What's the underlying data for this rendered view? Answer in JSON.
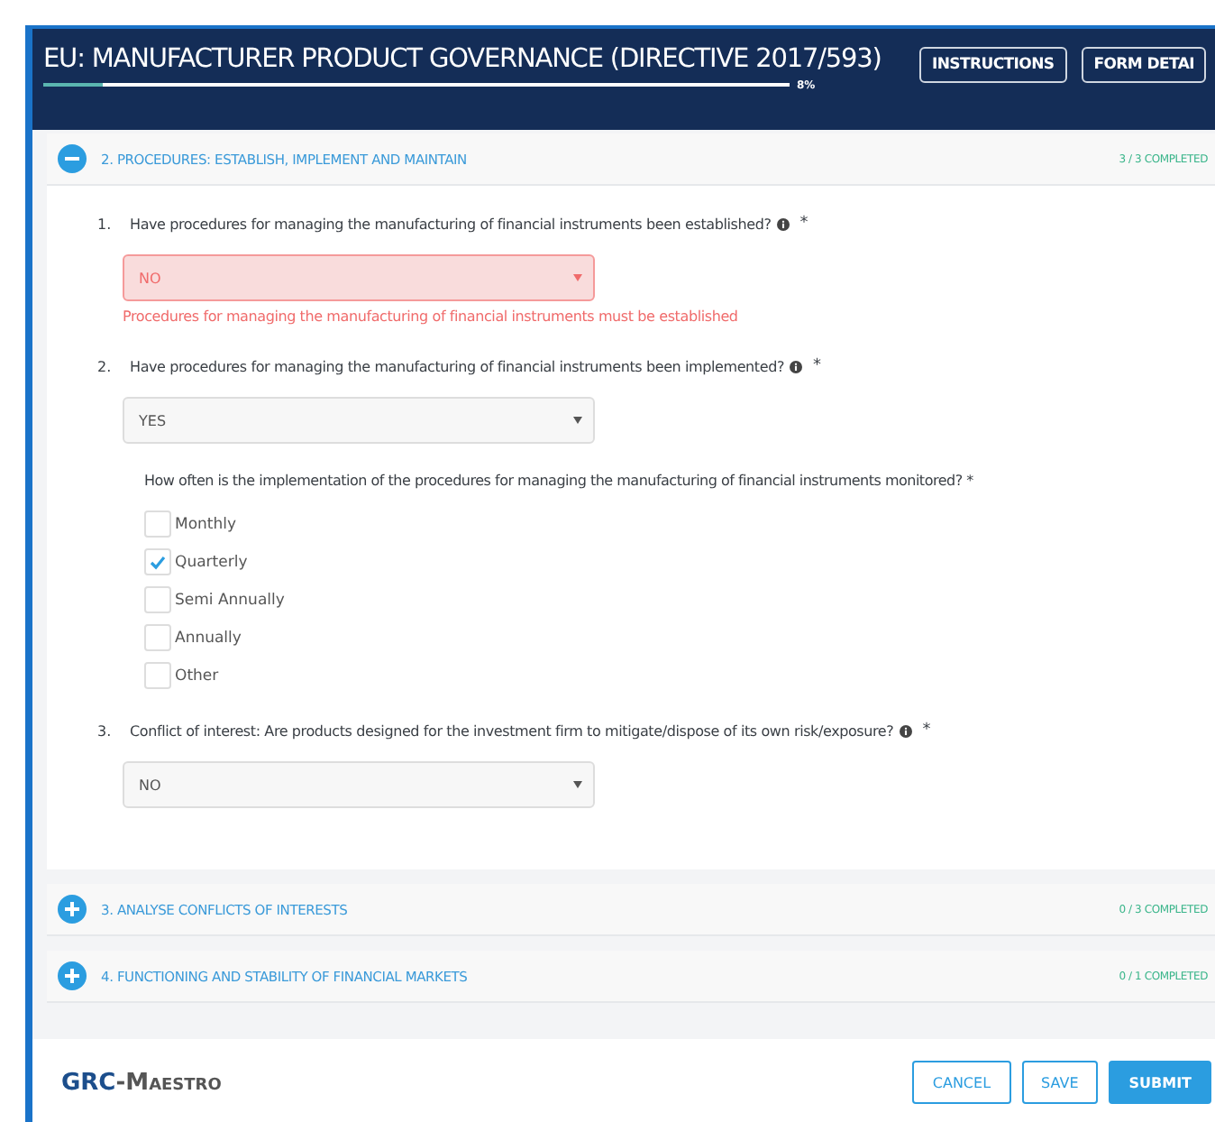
{
  "header": {
    "title": "EU: MANUFACTURER PRODUCT GOVERNANCE (DIRECTIVE 2017/593)",
    "progress": {
      "level": 0.08,
      "reading": "8%"
    },
    "buttons": [
      "INSTRUCTIONS",
      "FORM DETAI"
    ]
  },
  "sections": [
    {
      "title": "2. PROCEDURES: ESTABLISH, IMPLEMENT AND MAINTAIN",
      "expanded": true,
      "completed": "3 / 3 COMPLETED",
      "questions": [
        {
          "number": "1.",
          "text": "Have procedures for managing the manufacturing of financial instruments been established?",
          "required": "*",
          "answer": "NO",
          "error": "Procedures for managing the manufacturing of financial instruments must be established"
        },
        {
          "number": "2.",
          "text": "Have procedures for managing the manufacturing of financial instruments been implemented?",
          "required": "*",
          "answer": "YES",
          "followup": {
            "text": "How often is the implementation of the procedures for managing the manufacturing of financial instruments monitored?",
            "required": "*",
            "options": [
              {
                "label": "Monthly",
                "checked": false
              },
              {
                "label": "Quarterly",
                "checked": true
              },
              {
                "label": "Semi Annually",
                "checked": false
              },
              {
                "label": "Annually",
                "checked": false
              },
              {
                "label": "Other",
                "checked": false
              }
            ]
          }
        },
        {
          "number": "3.",
          "text": "Conflict of interest: Are products designed for the investment firm to mitigate/dispose of its own risk/exposure?",
          "required": "*",
          "answer": "NO"
        }
      ]
    },
    {
      "title": "3. ANALYSE CONFLICTS OF INTERESTS",
      "expanded": false,
      "completed": "0 / 3 COMPLETED"
    },
    {
      "title": "4. FUNCTIONING AND STABILITY OF FINANCIAL MARKETS",
      "expanded": false,
      "completed": "0 / 1 COMPLETED"
    }
  ],
  "footer": {
    "logo": {
      "first": "GRC",
      "second": "-Maestro"
    },
    "buttons": [
      {
        "label": "CANCEL",
        "kind": "outline"
      },
      {
        "label": "SAVE",
        "kind": "outline"
      },
      {
        "label": "SUBMIT",
        "kind": "primary"
      }
    ]
  }
}
